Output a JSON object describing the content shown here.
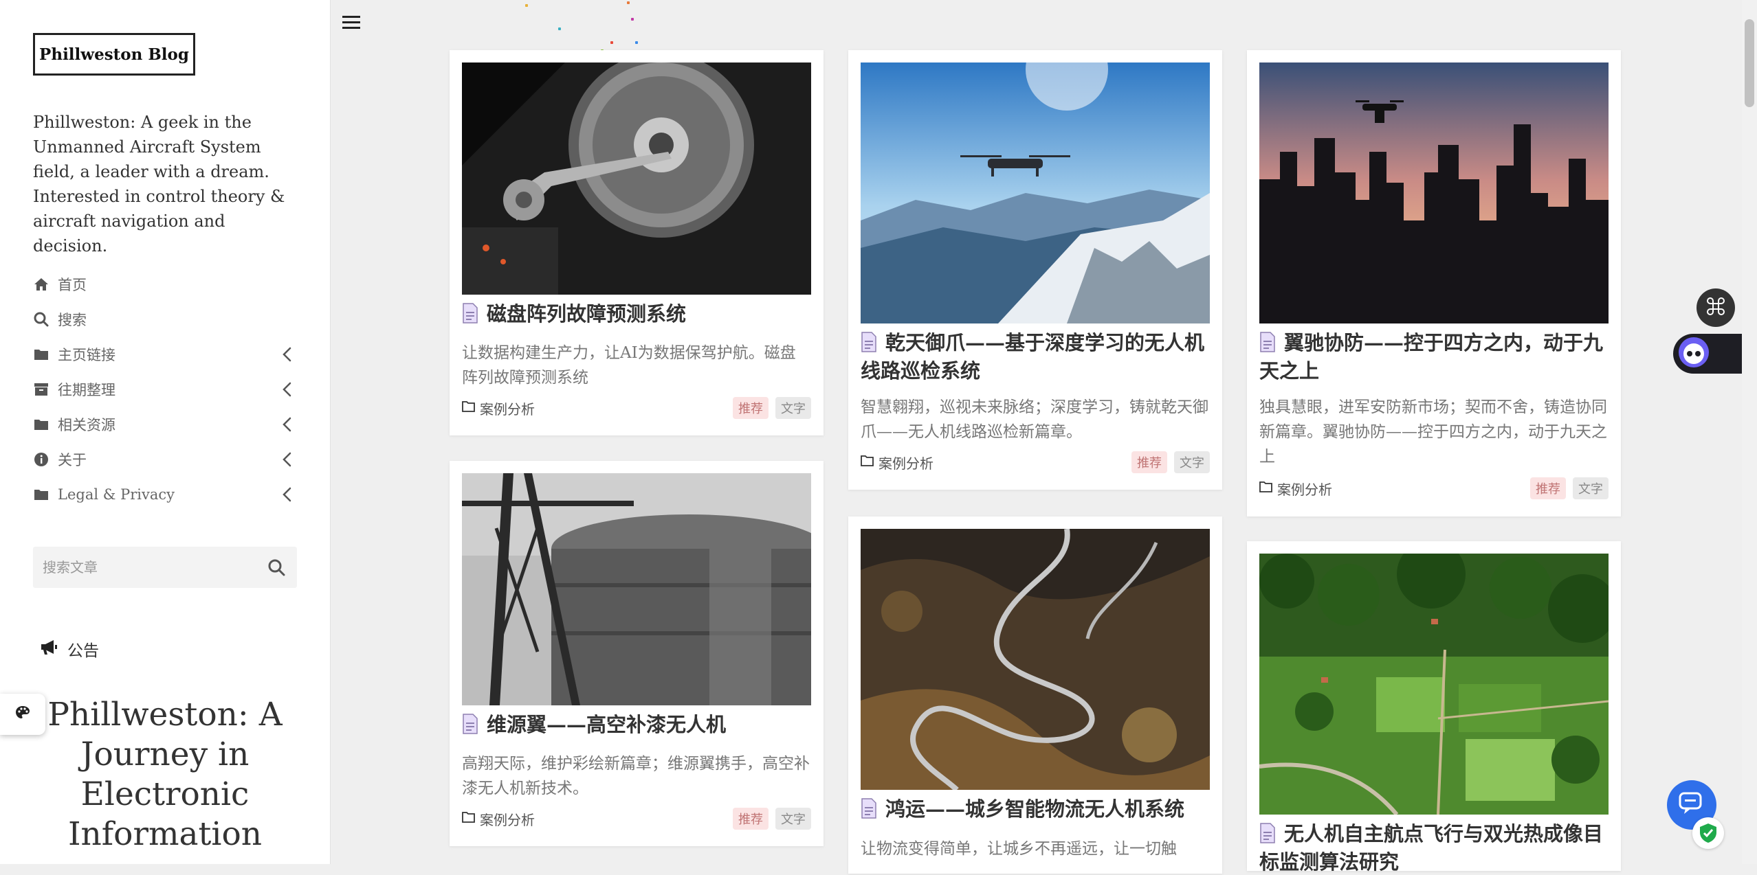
{
  "sidebar": {
    "blog_title": "Phillweston Blog",
    "description": "Phillweston: A geek in the Unmanned Aircraft System field, a leader with a dream. Interested in control theory & aircraft navigation and decision.",
    "nav": [
      {
        "label": "首页",
        "icon": "home-icon",
        "has_children": false
      },
      {
        "label": "搜索",
        "icon": "search-icon",
        "has_children": false
      },
      {
        "label": "主页链接",
        "icon": "folder-icon",
        "has_children": true
      },
      {
        "label": "往期整理",
        "icon": "archive-icon",
        "has_children": true
      },
      {
        "label": "相关资源",
        "icon": "folder-icon",
        "has_children": true
      },
      {
        "label": "关于",
        "icon": "info-icon",
        "has_children": true
      },
      {
        "label": "Legal & Privacy",
        "icon": "folder-icon",
        "has_children": true
      }
    ],
    "search_placeholder": "搜索文章",
    "notice_label": "公告",
    "notice_title": "Phillweston: A Journey in Electronic Information"
  },
  "posts": [
    {
      "title": "磁盘阵列故障预测系统",
      "excerpt": "让数据构建生产力，让AI为数据保驾护航。磁盘阵列故障预测系统",
      "category": "案例分析",
      "tags": [
        "推荐",
        "文字"
      ],
      "image": "hard-drive"
    },
    {
      "title": "乾天御爪——基于深度学习的无人机线路巡检系统",
      "excerpt": "智慧翱翔，巡视未来脉络；深度学习，铸就乾天御爪——无人机线路巡检新篇章。",
      "category": "案例分析",
      "tags": [
        "推荐",
        "文字"
      ],
      "image": "drone-mountains"
    },
    {
      "title": "翼驰协防——控于四方之内，动于九天之上",
      "excerpt": "独具慧眼，进军安防新市场；契而不舍，铸造协同新篇章。翼驰协防——控于四方之内，动于九天之上",
      "category": "案例分析",
      "tags": [
        "推荐",
        "文字"
      ],
      "image": "drone-city"
    },
    {
      "title": "维源翼——高空补漆无人机",
      "excerpt": "高翔天际，维护彩绘新篇章；维源翼携手，高空补漆无人机新技术。",
      "category": "案例分析",
      "tags": [
        "推荐",
        "文字"
      ],
      "image": "tank"
    },
    {
      "title": "鸿运——城乡智能物流无人机系统",
      "excerpt": "让物流变得简单，让城乡不再遥远，让一切触",
      "category": "",
      "tags": [],
      "image": "winding-road"
    },
    {
      "title": "无人机自主航点飞行与双光热成像目标监测算法研究",
      "excerpt": "",
      "category": "",
      "tags": [],
      "image": "farmland"
    }
  ],
  "colors": {
    "accent_red": "#c07474",
    "chat_blue": "#2f6fea"
  }
}
